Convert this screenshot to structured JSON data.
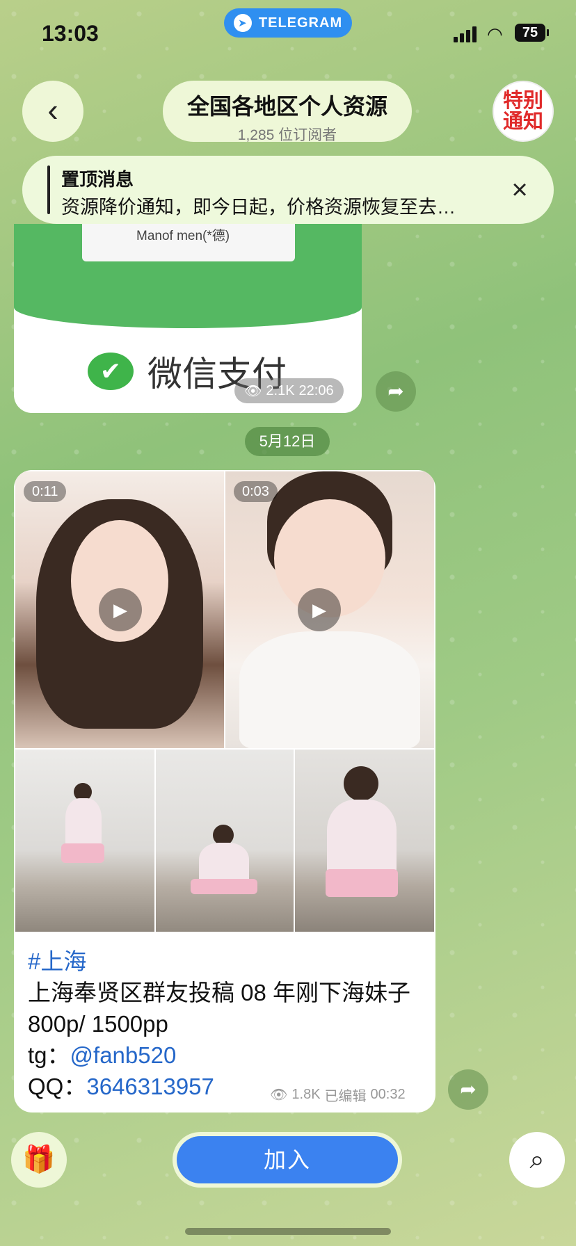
{
  "status_bar": {
    "time": "13:03",
    "pill_label": "TELEGRAM",
    "battery": "75"
  },
  "header": {
    "channel_title": "全国各地区个人资源",
    "subscribers": "1,285 位订阅者",
    "avatar_line1": "特别",
    "avatar_line2": "通知"
  },
  "pinned": {
    "title": "置顶消息",
    "text": "资源降价通知，即今日起，价格资源恢复至去…"
  },
  "message1": {
    "qr_caption": "Manof men(*德)",
    "wechat_label": "微信支付",
    "views": "2.1K",
    "time": "22:06"
  },
  "date_separator": "5月12日",
  "message2": {
    "video1_duration": "0:11",
    "video2_duration": "0:03",
    "hashtag": "#上海",
    "line1": "上海奉贤区群友投稿 08 年刚下海妹子",
    "line2": "800p/ 1500pp",
    "tg_label": "tg：",
    "tg_handle": "@fanb520",
    "qq_label": "QQ：",
    "qq_number": "3646313957",
    "views": "1.8K",
    "edited": "已编辑",
    "time": "00:32"
  },
  "bottom_bar": {
    "join_label": "加入"
  },
  "icons": {
    "back": "chevron-left-icon",
    "close": "close-icon",
    "share": "share-icon",
    "gift": "gift-icon",
    "search": "search-icon",
    "views": "eye-icon",
    "play": "play-icon"
  }
}
